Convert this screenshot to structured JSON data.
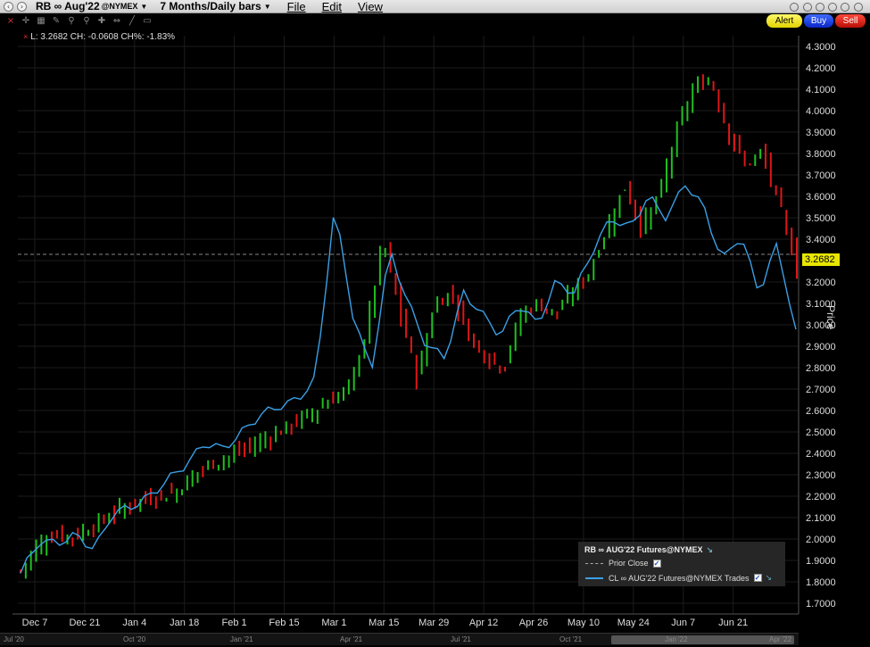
{
  "window": {
    "symbol": "RB ∞ Aug'22",
    "exchange": "@NYMEX",
    "period": "7 Months/Daily bars",
    "menus": [
      "File",
      "Edit",
      "View"
    ]
  },
  "toolbar": {
    "alert_label": "Alert",
    "buy_label": "Buy",
    "sell_label": "Sell"
  },
  "readout": "L: 3.2682 CH: -0.0608 CH%: -1.83%",
  "axis": {
    "y_title": "Price",
    "last_price": "3.2682",
    "y_ticks": [
      "4.3000",
      "4.2000",
      "4.1000",
      "4.0000",
      "3.9000",
      "3.8000",
      "3.7000",
      "3.6000",
      "3.5000",
      "3.4000",
      "3.3000",
      "3.2000",
      "3.1000",
      "3.0000",
      "2.9000",
      "2.8000",
      "2.7000",
      "2.6000",
      "2.5000",
      "2.4000",
      "2.3000",
      "2.2000",
      "2.1000",
      "2.0000",
      "1.9000",
      "1.8000",
      "1.7000"
    ],
    "x_ticks": [
      "Dec 7",
      "Dec 21",
      "Jan 4",
      "Jan 18",
      "Feb 1",
      "Feb 15",
      "Mar 1",
      "Mar 15",
      "Mar 29",
      "Apr 12",
      "Apr 26",
      "May 10",
      "May 24",
      "Jun 7",
      "Jun 21"
    ]
  },
  "legend": {
    "title": "RB ∞ AUG'22 Futures@NYMEX",
    "prior_close_label": "Prior Close",
    "cl_label": "CL ∞ AUG'22 Futures@NYMEX Trades"
  },
  "scrollbar_labels": [
    "Jul '20",
    "Oct '20",
    "Jan '21",
    "Apr '21",
    "Jul '21",
    "Oct '21",
    "Jan '22",
    "Apr '22"
  ],
  "colors": {
    "up": "#1fbf1f",
    "down": "#e01616",
    "cl_line": "#3aa0e6",
    "last_tag": "#e8e600"
  },
  "chart_data": {
    "type": "line",
    "title": "",
    "ylabel": "Price",
    "ylim": [
      1.65,
      4.35
    ],
    "prior_close": 3.329,
    "x": [
      "Dec 7",
      "Dec 21",
      "Jan 4",
      "Jan 18",
      "Feb 1",
      "Feb 15",
      "Mar 1",
      "Mar 15",
      "Mar 29",
      "Apr 12",
      "Apr 26",
      "May 10",
      "May 24",
      "Jun 7",
      "Jun 21"
    ],
    "series": [
      {
        "name": "RB ∞ AUG'22 Futures@NYMEX",
        "style": "ohlc",
        "values": [
          1.85,
          1.98,
          2.02,
          2.01,
          2.05,
          2.1,
          2.15,
          2.18,
          2.2,
          2.22,
          2.3,
          2.35,
          2.38,
          2.42,
          2.46,
          2.5,
          2.55,
          2.6,
          2.65,
          2.7,
          2.95,
          3.4,
          3.05,
          2.75,
          3.1,
          3.15,
          2.95,
          2.85,
          2.8,
          3.05,
          3.1,
          3.05,
          3.15,
          3.25,
          3.45,
          3.65,
          3.45,
          3.6,
          3.9,
          4.1,
          4.15,
          3.9,
          3.75,
          3.8,
          3.55,
          3.27
        ]
      },
      {
        "name": "CL ∞ AUG'22 Futures@NYMEX Trades",
        "style": "line",
        "values": [
          1.84,
          1.99,
          1.98,
          2.02,
          1.95,
          2.12,
          2.15,
          2.2,
          2.28,
          2.35,
          2.45,
          2.42,
          2.5,
          2.58,
          2.62,
          2.65,
          2.75,
          3.55,
          3.05,
          2.78,
          3.35,
          3.1,
          2.9,
          2.85,
          3.15,
          3.05,
          2.95,
          3.1,
          3.0,
          3.2,
          3.15,
          3.35,
          3.5,
          3.45,
          3.6,
          3.5,
          3.66,
          3.55,
          3.3,
          3.42,
          3.15,
          3.38,
          2.96
        ]
      }
    ]
  }
}
